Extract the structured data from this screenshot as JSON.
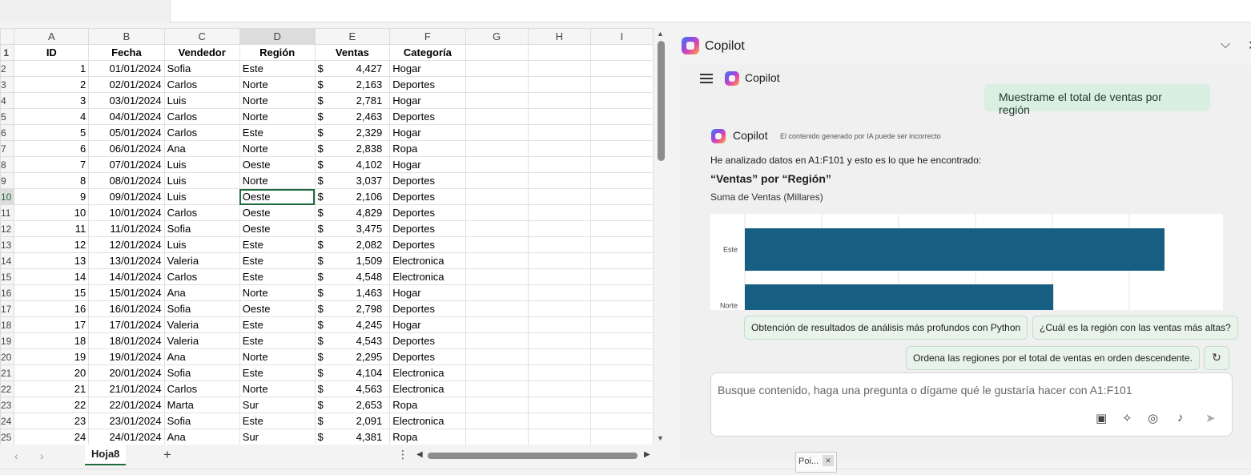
{
  "grid": {
    "col_headers": [
      "A",
      "B",
      "C",
      "D",
      "E",
      "F",
      "G",
      "H",
      "I"
    ],
    "header_row_num": "1",
    "header": {
      "id": "ID",
      "fecha": "Fecha",
      "vendedor": "Vendedor",
      "region": "Región",
      "ventas": "Ventas",
      "categoria": "Categoría"
    },
    "currency": "$",
    "rows": [
      {
        "n": "2",
        "id": "1",
        "fecha": "01/01/2024",
        "vendedor": "Sofia",
        "region": "Este",
        "ventas": "4,427",
        "categoria": "Hogar"
      },
      {
        "n": "3",
        "id": "2",
        "fecha": "02/01/2024",
        "vendedor": "Carlos",
        "region": "Norte",
        "ventas": "2,163",
        "categoria": "Deportes"
      },
      {
        "n": "4",
        "id": "3",
        "fecha": "03/01/2024",
        "vendedor": "Luis",
        "region": "Norte",
        "ventas": "2,781",
        "categoria": "Hogar"
      },
      {
        "n": "5",
        "id": "4",
        "fecha": "04/01/2024",
        "vendedor": "Carlos",
        "region": "Norte",
        "ventas": "2,463",
        "categoria": "Deportes"
      },
      {
        "n": "6",
        "id": "5",
        "fecha": "05/01/2024",
        "vendedor": "Carlos",
        "region": "Este",
        "ventas": "2,329",
        "categoria": "Hogar"
      },
      {
        "n": "7",
        "id": "6",
        "fecha": "06/01/2024",
        "vendedor": "Ana",
        "region": "Norte",
        "ventas": "2,838",
        "categoria": "Ropa"
      },
      {
        "n": "8",
        "id": "7",
        "fecha": "07/01/2024",
        "vendedor": "Luis",
        "region": "Oeste",
        "ventas": "4,102",
        "categoria": "Hogar"
      },
      {
        "n": "9",
        "id": "8",
        "fecha": "08/01/2024",
        "vendedor": "Luis",
        "region": "Norte",
        "ventas": "3,037",
        "categoria": "Deportes"
      },
      {
        "n": "10",
        "id": "9",
        "fecha": "09/01/2024",
        "vendedor": "Luis",
        "region": "Oeste",
        "ventas": "2,106",
        "categoria": "Deportes"
      },
      {
        "n": "11",
        "id": "10",
        "fecha": "10/01/2024",
        "vendedor": "Carlos",
        "region": "Oeste",
        "ventas": "4,829",
        "categoria": "Deportes"
      },
      {
        "n": "12",
        "id": "11",
        "fecha": "11/01/2024",
        "vendedor": "Sofia",
        "region": "Oeste",
        "ventas": "3,475",
        "categoria": "Deportes"
      },
      {
        "n": "13",
        "id": "12",
        "fecha": "12/01/2024",
        "vendedor": "Luis",
        "region": "Este",
        "ventas": "2,082",
        "categoria": "Deportes"
      },
      {
        "n": "14",
        "id": "13",
        "fecha": "13/01/2024",
        "vendedor": "Valeria",
        "region": "Este",
        "ventas": "1,509",
        "categoria": "Electronica"
      },
      {
        "n": "15",
        "id": "14",
        "fecha": "14/01/2024",
        "vendedor": "Carlos",
        "region": "Este",
        "ventas": "4,548",
        "categoria": "Electronica"
      },
      {
        "n": "16",
        "id": "15",
        "fecha": "15/01/2024",
        "vendedor": "Ana",
        "region": "Norte",
        "ventas": "1,463",
        "categoria": "Hogar"
      },
      {
        "n": "17",
        "id": "16",
        "fecha": "16/01/2024",
        "vendedor": "Sofia",
        "region": "Oeste",
        "ventas": "2,798",
        "categoria": "Deportes"
      },
      {
        "n": "18",
        "id": "17",
        "fecha": "17/01/2024",
        "vendedor": "Valeria",
        "region": "Este",
        "ventas": "4,245",
        "categoria": "Hogar"
      },
      {
        "n": "19",
        "id": "18",
        "fecha": "18/01/2024",
        "vendedor": "Valeria",
        "region": "Este",
        "ventas": "4,543",
        "categoria": "Deportes"
      },
      {
        "n": "20",
        "id": "19",
        "fecha": "19/01/2024",
        "vendedor": "Ana",
        "region": "Norte",
        "ventas": "2,295",
        "categoria": "Deportes"
      },
      {
        "n": "21",
        "id": "20",
        "fecha": "20/01/2024",
        "vendedor": "Sofia",
        "region": "Este",
        "ventas": "4,104",
        "categoria": "Electronica"
      },
      {
        "n": "22",
        "id": "21",
        "fecha": "21/01/2024",
        "vendedor": "Carlos",
        "region": "Norte",
        "ventas": "4,563",
        "categoria": "Electronica"
      },
      {
        "n": "23",
        "id": "22",
        "fecha": "22/01/2024",
        "vendedor": "Marta",
        "region": "Sur",
        "ventas": "2,653",
        "categoria": "Ropa"
      },
      {
        "n": "24",
        "id": "23",
        "fecha": "23/01/2024",
        "vendedor": "Sofia",
        "region": "Este",
        "ventas": "2,091",
        "categoria": "Electronica"
      },
      {
        "n": "25",
        "id": "24",
        "fecha": "24/01/2024",
        "vendedor": "Ana",
        "region": "Sur",
        "ventas": "4,381",
        "categoria": "Ropa"
      }
    ],
    "selected_column": "D",
    "active_row": "10"
  },
  "sheet_tab": "Hoja8",
  "copilot": {
    "pane_title": "Copilot",
    "inner_title": "Copilot",
    "user_message": "Muestrame el total de ventas por región",
    "response_name": "Copilot",
    "disclaimer": "El contenido generado por IA puede ser incorrecto",
    "analysis_text": "He analizado datos en A1:F101 y esto es lo que he encontrado:",
    "result_heading": "“Ventas” por “Región”",
    "result_sub": "Suma de Ventas (Millares)",
    "suggestions": [
      "Obtención de resultados de análisis más profundos con Python",
      "¿Cuál es la región con las ventas más altas?",
      "Ordena las regiones por el total de ventas en orden descendente."
    ],
    "input_placeholder": "Busque contenido, haga una pregunta o dígame qué le gustaría hacer con A1:F101"
  },
  "chart_data": {
    "type": "bar",
    "orientation": "horizontal",
    "categories": [
      "Este",
      "Norte"
    ],
    "values": [
      1.0,
      0.735
    ],
    "bar_color": "#175f82",
    "grid": true
  },
  "tooltip": {
    "text": "Poi..."
  },
  "colors": {
    "accent": "#1e6b3a",
    "chip_bg": "#e8f3ec",
    "user_bubble": "#d9efe1"
  }
}
